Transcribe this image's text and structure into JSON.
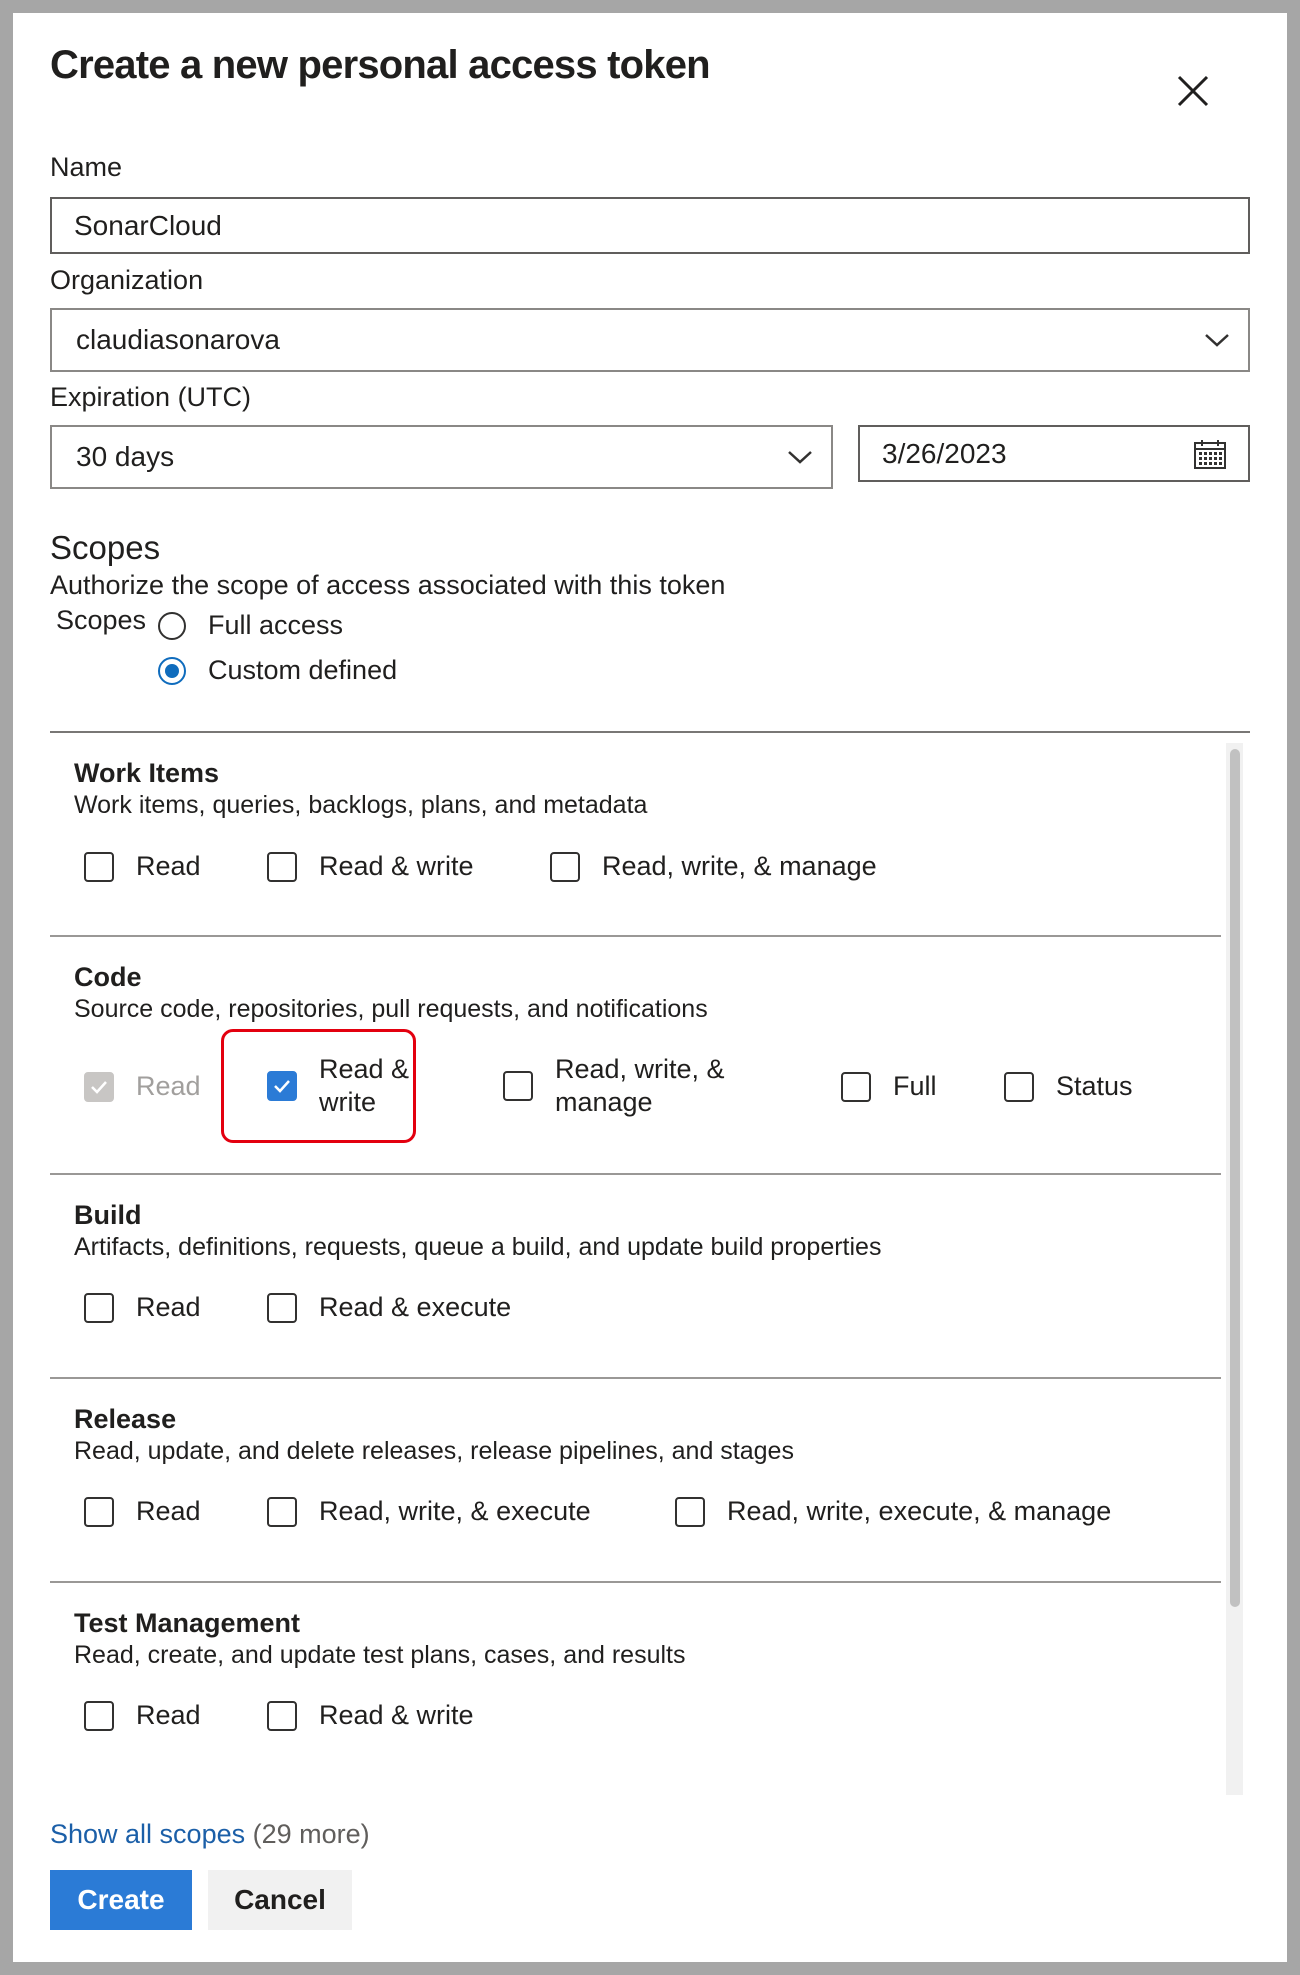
{
  "dialog": {
    "title": "Create a new personal access token",
    "name_label": "Name",
    "name_value": "SonarCloud",
    "organization_label": "Organization",
    "organization_value": "claudiasonarova",
    "expiration_label": "Expiration (UTC)",
    "expiration_value": "30 days",
    "expiration_date": "3/26/2023",
    "scopes_heading": "Scopes",
    "scopes_desc": "Authorize the scope of access associated with this token",
    "scopes_group_label": "Scopes",
    "scope_options": [
      {
        "label": "Full access",
        "selected": false
      },
      {
        "label": "Custom defined",
        "selected": true
      }
    ]
  },
  "sections": [
    {
      "title": "Work Items",
      "desc": "Work items, queries, backlogs, plans, and metadata",
      "options": [
        {
          "label": "Read",
          "checked": false
        },
        {
          "label": "Read & write",
          "checked": false
        },
        {
          "label": "Read, write, & manage",
          "checked": false
        }
      ]
    },
    {
      "title": "Code",
      "desc": "Source code, repositories, pull requests, and notifications",
      "options": [
        {
          "label": "Read",
          "checked": true,
          "disabled": true
        },
        {
          "label": "Read & write",
          "checked": true
        },
        {
          "label": "Read, write, & manage",
          "checked": false
        },
        {
          "label": "Full",
          "checked": false
        },
        {
          "label": "Status",
          "checked": false
        }
      ]
    },
    {
      "title": "Build",
      "desc": "Artifacts, definitions, requests, queue a build, and update build properties",
      "options": [
        {
          "label": "Read",
          "checked": false
        },
        {
          "label": "Read & execute",
          "checked": false
        }
      ]
    },
    {
      "title": "Release",
      "desc": "Read, update, and delete releases, release pipelines, and stages",
      "options": [
        {
          "label": "Read",
          "checked": false
        },
        {
          "label": "Read, write, & execute",
          "checked": false
        },
        {
          "label": "Read, write, execute, & manage",
          "checked": false
        }
      ]
    },
    {
      "title": "Test Management",
      "desc": "Read, create, and update test plans, cases, and results",
      "options": [
        {
          "label": "Read",
          "checked": false
        },
        {
          "label": "Read & write",
          "checked": false
        }
      ]
    }
  ],
  "footer": {
    "show_all_link": "Show all scopes",
    "more_count": "(29 more)",
    "create_label": "Create",
    "cancel_label": "Cancel"
  },
  "colors": {
    "accent": "#2b7bd6",
    "highlight_border": "#e3000f",
    "link": "#1b5fa8"
  }
}
